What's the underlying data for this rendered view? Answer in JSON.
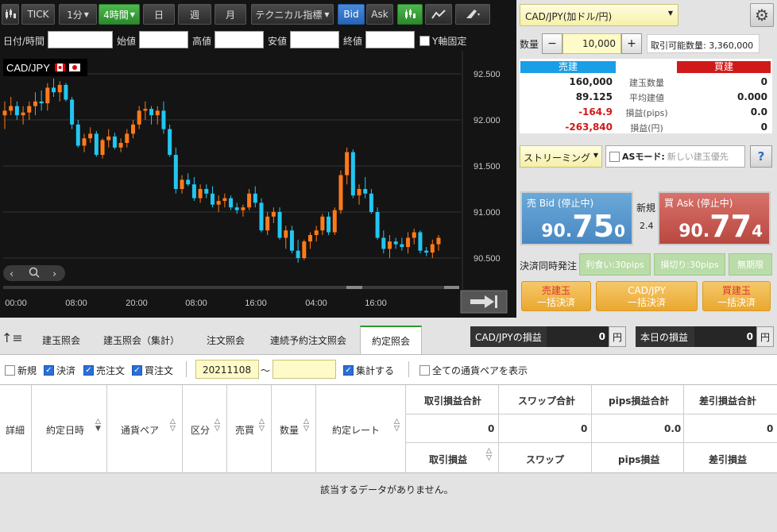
{
  "toolbar": {
    "tick": "TICK",
    "m1": "1分",
    "h4": "4時間",
    "day": "日",
    "week": "週",
    "month": "月",
    "tech": "テクニカル指標",
    "bid": "Bid",
    "ask": "Ask"
  },
  "ohlc": {
    "datetime": "日付/時間",
    "open": "始値",
    "high": "高値",
    "low": "安値",
    "close": "終値",
    "yfix": "Y軸固定"
  },
  "chart": {
    "symbol": "CAD/JPY",
    "yticks": [
      "92.500",
      "92.000",
      "91.500",
      "91.000",
      "90.500"
    ],
    "xticks": [
      "00:00",
      "08:00",
      "20:00",
      "08:00",
      "16:00",
      "04:00",
      "16:00"
    ],
    "up_color": "#ff7a1a",
    "down_color": "#22c6f0",
    "candles": [
      [
        92.05,
        92.2,
        91.9,
        92.1
      ],
      [
        92.1,
        92.25,
        92.05,
        92.15
      ],
      [
        92.15,
        92.2,
        92.0,
        92.05
      ],
      [
        92.05,
        92.15,
        91.95,
        92.08
      ],
      [
        92.08,
        92.2,
        92.0,
        92.15
      ],
      [
        92.15,
        92.3,
        92.05,
        92.2
      ],
      [
        92.2,
        92.32,
        92.1,
        92.18
      ],
      [
        92.18,
        92.4,
        92.1,
        92.35
      ],
      [
        92.35,
        92.45,
        92.25,
        92.3
      ],
      [
        92.3,
        92.42,
        92.2,
        92.38
      ],
      [
        92.38,
        92.4,
        92.2,
        92.22
      ],
      [
        92.22,
        92.25,
        91.9,
        91.95
      ],
      [
        91.95,
        92.0,
        91.7,
        91.72
      ],
      [
        91.72,
        91.85,
        91.65,
        91.8
      ],
      [
        91.8,
        91.92,
        91.75,
        91.85
      ],
      [
        91.85,
        91.88,
        91.6,
        91.62
      ],
      [
        91.62,
        91.8,
        91.58,
        91.78
      ],
      [
        91.78,
        91.9,
        91.7,
        91.82
      ],
      [
        91.82,
        91.86,
        91.68,
        91.7
      ],
      [
        91.7,
        91.8,
        91.65,
        91.75
      ],
      [
        91.75,
        91.9,
        91.7,
        91.85
      ],
      [
        91.85,
        92.0,
        91.8,
        91.95
      ],
      [
        91.95,
        92.15,
        91.9,
        92.1
      ],
      [
        92.1,
        92.2,
        92.0,
        92.12
      ],
      [
        92.12,
        92.15,
        91.95,
        92.05
      ],
      [
        92.05,
        92.15,
        91.95,
        92.1
      ],
      [
        92.1,
        92.2,
        91.85,
        91.9
      ],
      [
        91.9,
        91.95,
        91.6,
        91.62
      ],
      [
        91.62,
        91.7,
        91.2,
        91.25
      ],
      [
        91.25,
        91.4,
        91.2,
        91.35
      ],
      [
        91.35,
        91.42,
        91.28,
        91.3
      ],
      [
        91.3,
        91.38,
        91.12,
        91.15
      ],
      [
        91.15,
        91.3,
        91.1,
        91.25
      ],
      [
        91.25,
        91.3,
        91.15,
        91.2
      ],
      [
        91.2,
        91.28,
        91.05,
        91.08
      ],
      [
        91.08,
        91.18,
        91.0,
        91.12
      ],
      [
        91.12,
        91.2,
        91.05,
        91.15
      ],
      [
        91.15,
        91.18,
        91.02,
        91.05
      ],
      [
        91.05,
        91.1,
        90.98,
        91.02
      ],
      [
        91.02,
        91.08,
        90.95,
        91.05
      ],
      [
        91.05,
        91.25,
        91.02,
        91.2
      ],
      [
        91.2,
        91.28,
        91.05,
        91.1
      ],
      [
        91.1,
        91.15,
        90.78,
        90.8
      ],
      [
        90.8,
        91.0,
        90.75,
        90.95
      ],
      [
        90.95,
        91.05,
        90.88,
        91.0
      ],
      [
        91.0,
        91.05,
        90.7,
        90.72
      ],
      [
        90.72,
        90.85,
        90.6,
        90.8
      ],
      [
        90.8,
        90.85,
        90.55,
        90.58
      ],
      [
        90.58,
        90.7,
        90.45,
        90.5
      ],
      [
        90.5,
        90.7,
        90.48,
        90.68
      ],
      [
        90.68,
        90.78,
        90.6,
        90.75
      ],
      [
        90.75,
        90.85,
        90.68,
        90.8
      ],
      [
        90.8,
        90.98,
        90.75,
        90.95
      ],
      [
        90.95,
        91.0,
        90.75,
        90.78
      ],
      [
        90.78,
        91.05,
        90.75,
        91.02
      ],
      [
        91.02,
        91.45,
        90.98,
        91.4
      ],
      [
        91.4,
        91.7,
        91.3,
        91.65
      ],
      [
        91.65,
        91.68,
        91.15,
        91.18
      ],
      [
        91.18,
        91.3,
        91.08,
        91.25
      ],
      [
        91.25,
        91.38,
        91.15,
        91.2
      ],
      [
        91.2,
        91.25,
        90.98,
        91.0
      ],
      [
        91.0,
        91.05,
        90.7,
        90.72
      ],
      [
        90.72,
        90.8,
        90.55,
        90.6
      ],
      [
        90.6,
        90.75,
        90.5,
        90.68
      ],
      [
        90.68,
        90.72,
        90.6,
        90.65
      ],
      [
        90.65,
        90.72,
        90.58,
        90.62
      ],
      [
        90.62,
        90.78,
        90.55,
        90.72
      ],
      [
        90.72,
        90.82,
        90.65,
        90.78
      ],
      [
        90.78,
        90.8,
        90.55,
        90.58
      ],
      [
        90.58,
        90.62,
        90.52,
        90.56
      ],
      [
        90.56,
        90.7,
        90.5,
        90.65
      ],
      [
        90.65,
        90.75,
        90.58,
        90.72
      ]
    ]
  },
  "right": {
    "pair": "CAD/JPY(加ドル/円)",
    "qty_label": "数量",
    "qty_value": "10,000",
    "minus": "−",
    "plus": "+",
    "avail": "取引可能数量: 3,360,000",
    "sell_head": "売建",
    "buy_head": "買建",
    "rows": [
      {
        "label": "建玉数量",
        "sell": "160,000",
        "buy": "0"
      },
      {
        "label": "平均建値",
        "sell": "89.125",
        "buy": "0.000"
      },
      {
        "label": "損益(pips)",
        "sell": "-164.9",
        "buy": "0.0"
      },
      {
        "label": "損益(円)",
        "sell": "-263,840",
        "buy": "0"
      }
    ],
    "streaming": "ストリーミング",
    "asmode": "ASモード:",
    "asmode_hint": "新しい建玉優先",
    "help": "?",
    "bid_label": "売 Bid (停止中)",
    "bid_a": "90.",
    "bid_b": "75",
    "bid_c": "0",
    "ask_label": "買 Ask (停止中)",
    "ask_a": "90.",
    "ask_b": "77",
    "ask_c": "4",
    "shinki": "新規",
    "spread": "2.4",
    "kessai": "決済同時発注",
    "rigui": "利食い:30pips",
    "songiri": "損切り:30pips",
    "mukigen": "無期限",
    "btn_sell1": "売建玉",
    "btn_sell2": "一括決済",
    "btn_pair1": "CAD/JPY",
    "btn_pair2": "一括決済",
    "btn_buy1": "買建玉",
    "btn_buy2": "一括決済"
  },
  "tabs": [
    "建玉照会",
    "建玉照会（集計）",
    "注文照会",
    "連続予約注文照会",
    "約定照会"
  ],
  "pl": {
    "pair_label": "CAD/JPYの損益",
    "pair_value": "0",
    "today_label": "本日の損益",
    "today_value": "0",
    "unit": "円"
  },
  "filter": {
    "new": "新規",
    "settle": "決済",
    "sell": "売注文",
    "buy": "買注文",
    "from": "20211108",
    "tilde": "〜",
    "agg": "集計する",
    "allpairs": "全ての通貨ペアを表示"
  },
  "grid": {
    "detail": "詳細",
    "date": "約定日時",
    "pair": "通貨ペア",
    "kubun": "区分",
    "baibai": "売買",
    "qty": "数量",
    "rate": "約定レート",
    "sum_pl": "取引損益合計",
    "sum_swap": "スワップ合計",
    "sum_pips": "pips損益合計",
    "sum_net": "差引損益合計",
    "v_pl": "0",
    "v_swap": "0",
    "v_pips": "0.0",
    "v_net": "0",
    "pl": "取引損益",
    "swap": "スワップ",
    "pips": "pips損益",
    "net": "差引損益",
    "empty": "該当するデータがありません。"
  }
}
